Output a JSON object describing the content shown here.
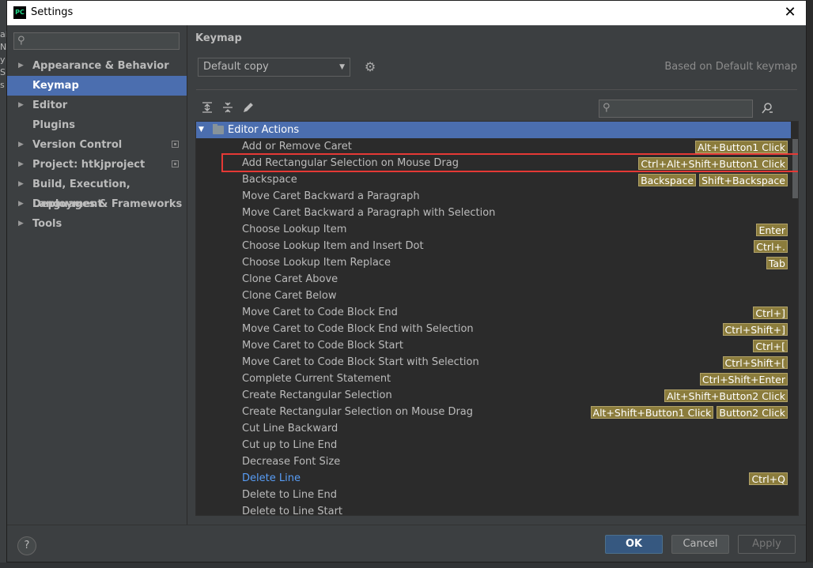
{
  "window": {
    "title": "Settings",
    "close_glyph": "✕",
    "app_icon_text": "PC"
  },
  "sidebar": {
    "search_placeholder": "",
    "items": [
      {
        "label": "Appearance & Behavior",
        "expandable": true,
        "selected": false,
        "project_icon": false
      },
      {
        "label": "Keymap",
        "expandable": false,
        "selected": true,
        "project_icon": false
      },
      {
        "label": "Editor",
        "expandable": true,
        "selected": false,
        "project_icon": false
      },
      {
        "label": "Plugins",
        "expandable": false,
        "selected": false,
        "project_icon": false
      },
      {
        "label": "Version Control",
        "expandable": true,
        "selected": false,
        "project_icon": true
      },
      {
        "label": "Project: htkjproject",
        "expandable": true,
        "selected": false,
        "project_icon": true
      },
      {
        "label": "Build, Execution, Deployment",
        "expandable": true,
        "selected": false,
        "project_icon": false
      },
      {
        "label": "Languages & Frameworks",
        "expandable": true,
        "selected": false,
        "project_icon": false
      },
      {
        "label": "Tools",
        "expandable": true,
        "selected": false,
        "project_icon": false
      }
    ]
  },
  "keymap": {
    "page_title": "Keymap",
    "selected_keymap": "Default copy",
    "based_on": "Based on Default keymap",
    "search_placeholder": "",
    "group": "Editor Actions",
    "actions": [
      {
        "name": "Add or Remove Caret",
        "shortcuts": [
          "Alt+Button1 Click"
        ]
      },
      {
        "name": "Add Rectangular Selection on Mouse Drag",
        "shortcuts": [
          "Ctrl+Alt+Shift+Button1 Click"
        ]
      },
      {
        "name": "Backspace",
        "shortcuts": [
          "Backspace",
          "Shift+Backspace"
        ]
      },
      {
        "name": "Move Caret Backward a Paragraph",
        "shortcuts": []
      },
      {
        "name": "Move Caret Backward a Paragraph with Selection",
        "shortcuts": []
      },
      {
        "name": "Choose Lookup Item",
        "shortcuts": [
          "Enter"
        ]
      },
      {
        "name": "Choose Lookup Item and Insert Dot",
        "shortcuts": [
          "Ctrl+."
        ]
      },
      {
        "name": "Choose Lookup Item Replace",
        "shortcuts": [
          "Tab"
        ]
      },
      {
        "name": "Clone Caret Above",
        "shortcuts": []
      },
      {
        "name": "Clone Caret Below",
        "shortcuts": []
      },
      {
        "name": "Move Caret to Code Block End",
        "shortcuts": [
          "Ctrl+]"
        ]
      },
      {
        "name": "Move Caret to Code Block End with Selection",
        "shortcuts": [
          "Ctrl+Shift+]"
        ]
      },
      {
        "name": "Move Caret to Code Block Start",
        "shortcuts": [
          "Ctrl+["
        ]
      },
      {
        "name": "Move Caret to Code Block Start with Selection",
        "shortcuts": [
          "Ctrl+Shift+["
        ]
      },
      {
        "name": "Complete Current Statement",
        "shortcuts": [
          "Ctrl+Shift+Enter"
        ]
      },
      {
        "name": "Create Rectangular Selection",
        "shortcuts": [
          "Alt+Shift+Button2 Click"
        ]
      },
      {
        "name": "Create Rectangular Selection on Mouse Drag",
        "shortcuts": [
          "Alt+Shift+Button1 Click",
          "Button2 Click"
        ]
      },
      {
        "name": "Cut Line Backward",
        "shortcuts": []
      },
      {
        "name": "Cut up to Line End",
        "shortcuts": []
      },
      {
        "name": "Decrease Font Size",
        "shortcuts": []
      },
      {
        "name": "Delete Line",
        "shortcuts": [
          "Ctrl+Q"
        ],
        "modified": true
      },
      {
        "name": "Delete to Line End",
        "shortcuts": []
      },
      {
        "name": "Delete to Line Start",
        "shortcuts": []
      }
    ],
    "highlighted_action": "Add Rectangular Selection on Mouse Drag"
  },
  "footer": {
    "help": "?",
    "ok": "OK",
    "cancel": "Cancel",
    "apply": "Apply"
  },
  "colors": {
    "selection": "#4b6eaf",
    "shortcut_bg": "#8b7c3c",
    "modified_link": "#589df6",
    "highlight_border": "#e53935"
  },
  "icons": {
    "expand_all": "expand-all-icon",
    "collapse_all": "collapse-all-icon",
    "edit": "pencil-icon",
    "gear": "gear-icon",
    "find_by_shortcut": "find-shortcut-icon"
  }
}
